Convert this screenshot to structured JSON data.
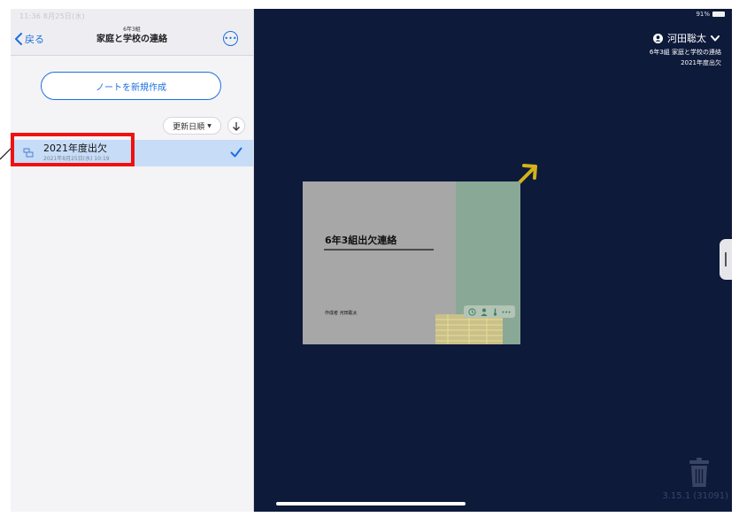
{
  "status_bar": {
    "time": "11:36 8月25日(水)",
    "battery": "91%"
  },
  "nav": {
    "back_label": "戻る",
    "subtitle": "6年3組",
    "title": "家庭と学校の連絡",
    "more_glyph": "•••"
  },
  "new_note_button": "ノートを新規作成",
  "sort": {
    "label": "更新日順",
    "caret": "▼"
  },
  "notes": [
    {
      "title": "2021年度出欠",
      "date": "2021年8月25日(水) 10:19",
      "selected": true
    }
  ],
  "header": {
    "user_name": "河田聡太",
    "class_label": "6年3組 家庭と学校の連絡",
    "note_label": "2021年度出欠"
  },
  "preview": {
    "title": "6年3組出欠連絡",
    "author": "作成者 河田聡太"
  },
  "version": "3.15.1 (31091)",
  "colors": {
    "background": "#0d1a3a",
    "accent": "#1c6fe0",
    "selection": "#c7dcf7",
    "highlight": "#ef1111",
    "arrow": "#d5b21a"
  },
  "icons": {
    "back": "chevron-left-icon",
    "more": "ellipsis-circle-icon",
    "sort_direction": "arrow-down-icon",
    "note": "note-icon",
    "check": "checkmark-icon",
    "user": "user-circle-icon",
    "user_menu": "chevron-down-icon",
    "trash": "trash-icon",
    "handle": "drawer-handle-icon"
  }
}
